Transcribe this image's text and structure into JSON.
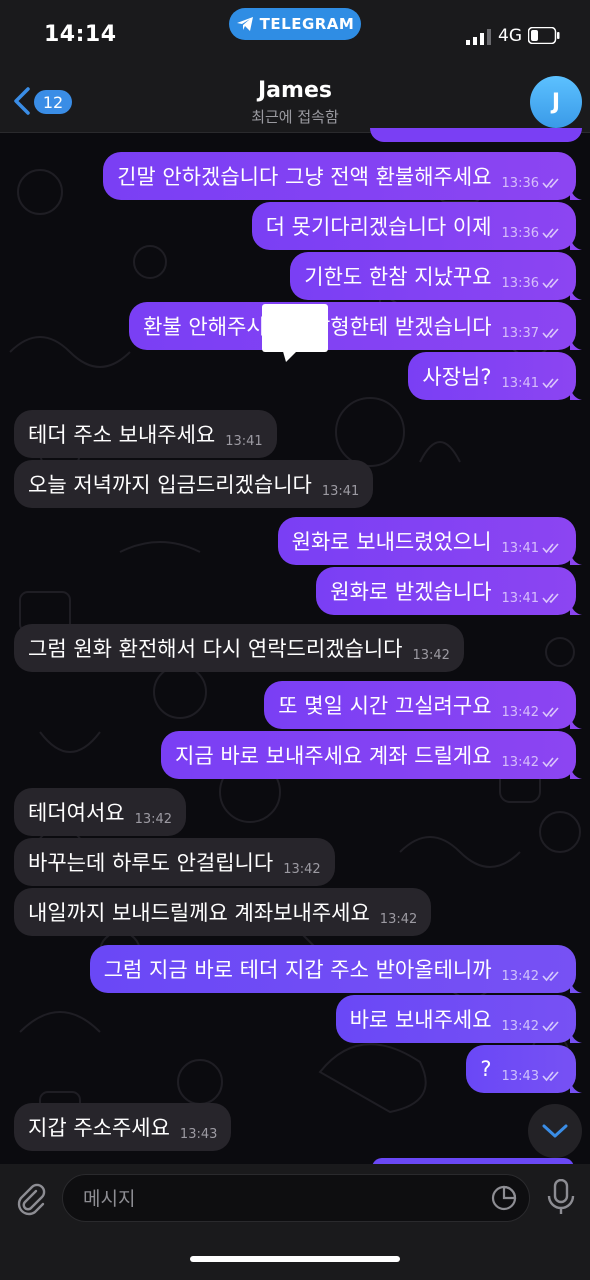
{
  "status_bar": {
    "time": "14:14",
    "app_pill": "TELEGRAM",
    "network": "4G"
  },
  "header": {
    "back_count": "12",
    "title": "James",
    "subtitle": "최근에 접속함",
    "avatar_letter": "J"
  },
  "messages": [
    {
      "dir": "out",
      "text": "긴말 안하겠습니다 그냥 전액 환불해주세요",
      "time": "13:36"
    },
    {
      "dir": "out",
      "text": "더 못기다리겠습니다 이제",
      "time": "13:36"
    },
    {
      "dir": "out",
      "text": "기한도 한참 지났꾸요",
      "time": "13:36"
    },
    {
      "dir": "out",
      "text": "환불 안해주시면 경찰형한테 받겠습니다",
      "time": "13:37"
    },
    {
      "dir": "out",
      "text": "사장님?",
      "time": "13:41"
    },
    {
      "dir": "in",
      "text": "테더 주소 보내주세요",
      "time": "13:41"
    },
    {
      "dir": "in",
      "text": "오늘 저녁까지 입금드리겠습니다",
      "time": "13:41"
    },
    {
      "dir": "out",
      "text": "원화로 보내드렸었으니",
      "time": "13:41"
    },
    {
      "dir": "out",
      "text": "원화로 받겠습니다",
      "time": "13:41"
    },
    {
      "dir": "in",
      "text": "그럼 원화 환전해서 다시 연락드리겠습니다",
      "time": "13:42"
    },
    {
      "dir": "out",
      "text": "또 몇일 시간 끄실려구요",
      "time": "13:42"
    },
    {
      "dir": "out",
      "text": "지금 바로 보내주세요 계좌 드릴게요",
      "time": "13:42"
    },
    {
      "dir": "in",
      "text": "테더여서요",
      "time": "13:42"
    },
    {
      "dir": "in",
      "text": "바꾸는데 하루도 안걸립니다",
      "time": "13:42"
    },
    {
      "dir": "in",
      "text": "내일까지 보내드릴께요 계좌보내주세요",
      "time": "13:42"
    },
    {
      "dir": "out",
      "text": "그럼 지금 바로 테더 지갑 주소 받아올테니까",
      "time": "13:42"
    },
    {
      "dir": "out",
      "text": "바로 보내주세요",
      "time": "13:42"
    },
    {
      "dir": "out",
      "text": "?",
      "time": "13:43"
    },
    {
      "dir": "in",
      "text": "지갑 주소주세요",
      "time": "13:43"
    }
  ],
  "composer": {
    "placeholder": "메시지"
  },
  "icons": {
    "back": "chevron-left-icon",
    "attach": "paperclip-icon",
    "sticker": "sticker-icon",
    "mic": "microphone-icon",
    "scroll_down": "chevron-down-icon",
    "read_receipt": "double-check-icon"
  },
  "colors": {
    "outgoing_bubble": "#7a3ff4",
    "incoming_bubble": "#27252b",
    "accent": "#3a8de6"
  }
}
